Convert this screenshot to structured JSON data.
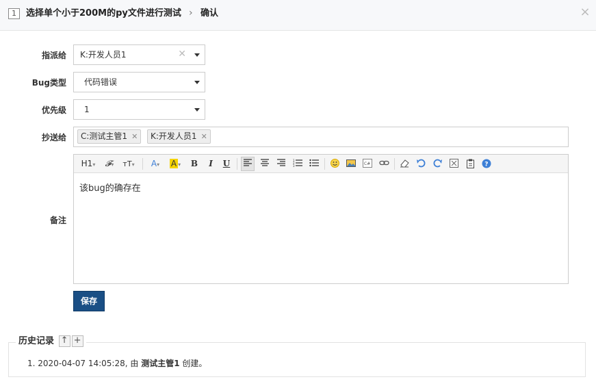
{
  "header": {
    "bug_id": "1",
    "title": "选择单个小于200M的py文件进行测试",
    "separator": "›",
    "action": "确认",
    "close": "×"
  },
  "form": {
    "assign_to": {
      "label": "指派给",
      "value": "K:开发人员1"
    },
    "bug_type": {
      "label": "Bug类型",
      "value": "代码错误"
    },
    "priority": {
      "label": "优先级",
      "value": "1"
    },
    "cc": {
      "label": "抄送给",
      "items": [
        "C:测试主管1",
        "K:开发人员1"
      ]
    },
    "comment": {
      "label": "备注",
      "content": "该bug的确存在"
    }
  },
  "toolbar": {
    "heading": "H1",
    "font_family": "𝓕",
    "font_size": "ᴛT",
    "font_color": "A",
    "bg_color": "A",
    "bold": "B",
    "italic": "I",
    "underline": "U",
    "help": "?"
  },
  "save_label": "保存",
  "history": {
    "legend": "历史记录",
    "up": "↑",
    "expand": "+",
    "entry": {
      "index": "1.",
      "time": "2020-04-07 14:05:28, 由",
      "user": "测试主管1",
      "action": "创建。"
    }
  },
  "colors": {
    "primary": "#1a4f85",
    "border": "#cccccc",
    "toolbar_bg": "#f5f5f5",
    "font_color_icon": "#3d7fd6",
    "highlight": "#f5d400"
  }
}
